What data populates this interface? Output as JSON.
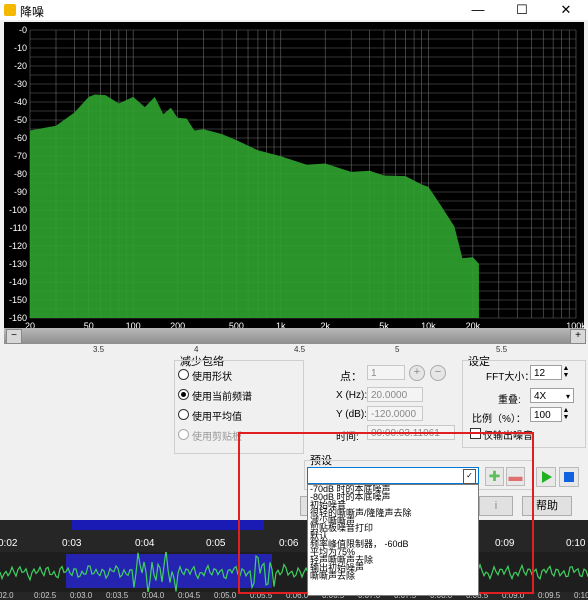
{
  "window": {
    "title": "降噪",
    "minimize": "—",
    "maximize": "☐",
    "close": "✕"
  },
  "spectrum": {
    "y_ticks": [
      "-0",
      "-10",
      "-20",
      "-30",
      "-40",
      "-50",
      "-60",
      "-70",
      "-80",
      "-90",
      "-100",
      "-110",
      "-120",
      "-130",
      "-140",
      "-150",
      "-160"
    ],
    "x_ticks": [
      "20",
      "50",
      "100",
      "200",
      "500",
      "1k",
      "2k",
      "5k",
      "10k",
      "20k",
      "100k"
    ],
    "colors": {
      "background": "#000000",
      "fill": "#2fa42f",
      "grid": "#6a6a6a"
    },
    "curve": [
      {
        "f": 20,
        "db": -55
      },
      {
        "f": 30,
        "db": -54
      },
      {
        "f": 40,
        "db": -45
      },
      {
        "f": 50,
        "db": -38
      },
      {
        "f": 55,
        "db": -35
      },
      {
        "f": 65,
        "db": -37
      },
      {
        "f": 80,
        "db": -40
      },
      {
        "f": 100,
        "db": -38
      },
      {
        "f": 120,
        "db": -42
      },
      {
        "f": 140,
        "db": -38
      },
      {
        "f": 160,
        "db": -46
      },
      {
        "f": 180,
        "db": -44
      },
      {
        "f": 200,
        "db": -48
      },
      {
        "f": 230,
        "db": -50
      },
      {
        "f": 260,
        "db": -55
      },
      {
        "f": 300,
        "db": -56
      },
      {
        "f": 400,
        "db": -57
      },
      {
        "f": 500,
        "db": -62
      },
      {
        "f": 700,
        "db": -66
      },
      {
        "f": 1000,
        "db": -71
      },
      {
        "f": 1500,
        "db": -74
      },
      {
        "f": 2000,
        "db": -75
      },
      {
        "f": 3000,
        "db": -78
      },
      {
        "f": 4000,
        "db": -79
      },
      {
        "f": 5000,
        "db": -80
      },
      {
        "f": 7000,
        "db": -82
      },
      {
        "f": 9000,
        "db": -85
      },
      {
        "f": 10000,
        "db": -88
      },
      {
        "f": 12000,
        "db": -96
      },
      {
        "f": 15000,
        "db": -110
      },
      {
        "f": 17000,
        "db": -126
      },
      {
        "f": 20000,
        "db": -127
      },
      {
        "f": 22000,
        "db": -129
      }
    ]
  },
  "ruler": {
    "labels": [
      "3.5",
      "4",
      "4.5",
      "5",
      "5.5"
    ]
  },
  "reduce_envelope": {
    "title": "减少包络",
    "options": [
      "使用形状",
      "使用当前频谱",
      "使用平均值",
      "使用剪贴板"
    ],
    "selected": 1
  },
  "point": {
    "label_point": "点：",
    "point_value": "1",
    "label_x": "X (Hz):",
    "x_value": "20.0000",
    "label_y": "Y (dB):",
    "y_value": "-120.0000",
    "label_time": "时间:",
    "time_value": "00:00:03.11061"
  },
  "settings": {
    "title": "设定",
    "fft_label": "FFT大小：",
    "fft_value": "12",
    "overlap_label": "重叠:",
    "overlap_value": "4X",
    "ratio_label": "比例（%）：",
    "ratio_value": "100",
    "output_noise_label": "仅输出噪音"
  },
  "presets": {
    "title": "预设",
    "items": [
      "-70dB 时的本底噪声",
      "-80dB 时的本底噪声",
      "初始噪音",
      "很轻的嘶嘶声/隆隆声去除",
      "减少嘶嘶声",
      "剪贴板噪音打印",
      "默认",
      "频率峰值限制器，  -60dB",
      "平均为75%",
      "轻声嘶嘶声去除",
      "输出初始噪声",
      "嘶嘶声去除"
    ],
    "add_icon": "plus-icon",
    "remove_icon": "minus-icon"
  },
  "footer": {
    "help": "帮助",
    "ok_partial": "i"
  },
  "timeline": {
    "labels": [
      "0:02",
      "0:03",
      "0:04",
      "0:05",
      "0:06",
      "0:07",
      "0:08",
      "0:09",
      "0:10"
    ],
    "small_labels": [
      "02.0",
      "0:02.5",
      "0:03.0",
      "0:03.5",
      "0:04.0",
      "0:04.5",
      "0:05.0",
      "0:05.5",
      "0:06.0",
      "0:06.5",
      "0:07.0",
      "0:07.5",
      "0:08.0",
      "0:08.5",
      "0:09.0",
      "0:09.5",
      "0:10"
    ]
  }
}
